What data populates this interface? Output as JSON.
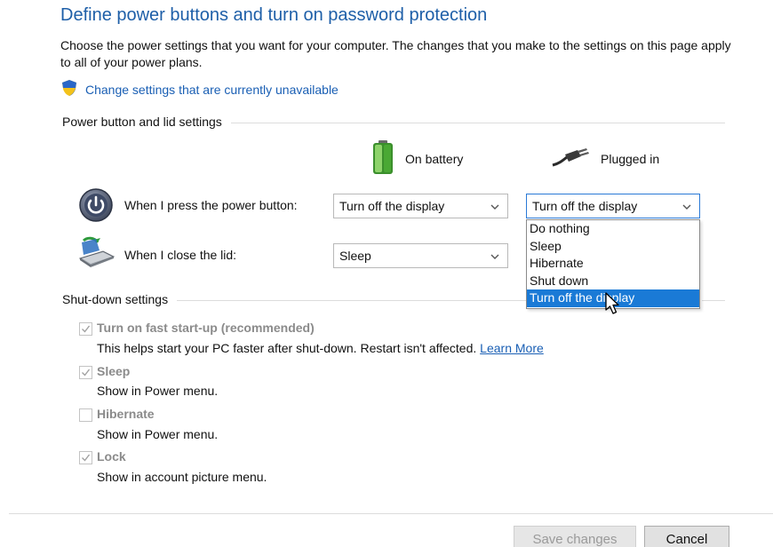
{
  "header": {
    "title": "Define power buttons and turn on password protection",
    "intro": "Choose the power settings that you want for your computer. The changes that you make to the settings on this page apply to all of your power plans.",
    "change_link": "Change settings that are currently unavailable"
  },
  "power_section": {
    "label": "Power button and lid settings",
    "columns": {
      "battery": "On battery",
      "plugged": "Plugged in"
    },
    "rows": [
      {
        "label": "When I press the power button:",
        "battery_value": "Turn off the display",
        "plugged_value": "Turn off the display"
      },
      {
        "label": "When I close the lid:",
        "battery_value": "Sleep",
        "plugged_value": ""
      }
    ],
    "dropdown_options": [
      "Do nothing",
      "Sleep",
      "Hibernate",
      "Shut down",
      "Turn off the display"
    ],
    "dropdown_selected": "Turn off the display"
  },
  "shutdown_section": {
    "label": "Shut-down settings",
    "items": [
      {
        "label": "Turn on fast start-up (recommended)",
        "checked": true,
        "desc": "This helps start your PC faster after shut-down. Restart isn't affected.",
        "link": "Learn More"
      },
      {
        "label": "Sleep",
        "checked": true,
        "desc": "Show in Power menu."
      },
      {
        "label": "Hibernate",
        "checked": false,
        "desc": "Show in Power menu."
      },
      {
        "label": "Lock",
        "checked": true,
        "desc": "Show in account picture menu."
      }
    ]
  },
  "footer": {
    "save_label": "Save changes",
    "cancel_label": "Cancel"
  },
  "colors": {
    "title": "#1e5fa8",
    "link": "#1a5fb4",
    "selection": "#1a7ad6",
    "disabled_text": "#8b8b8b"
  },
  "icons": [
    "shield-icon",
    "battery-icon",
    "plug-icon",
    "power-icon",
    "laptop-lid-icon",
    "chevron-down-icon",
    "checkmark-icon",
    "mouse-cursor-icon"
  ]
}
